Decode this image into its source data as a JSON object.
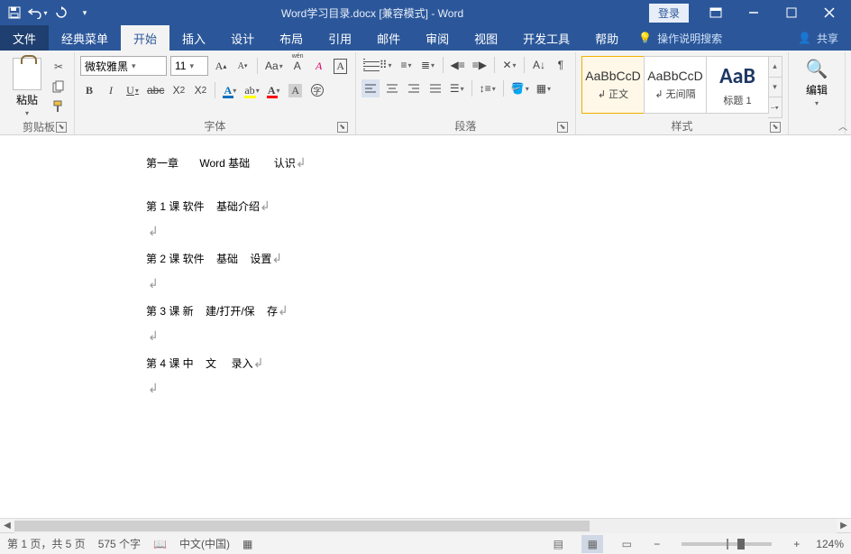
{
  "title": "Word学习目录.docx [兼容模式] - Word",
  "login": "登录",
  "tabs": {
    "file": "文件",
    "classic": "经典菜单",
    "home": "开始",
    "insert": "插入",
    "design": "设计",
    "layout": "布局",
    "ref": "引用",
    "mail": "邮件",
    "review": "审阅",
    "view": "视图",
    "dev": "开发工具",
    "help": "帮助",
    "tell": "操作说明搜索",
    "share": "共享"
  },
  "ribbon": {
    "clipboard": {
      "paste": "粘贴",
      "label": "剪贴板"
    },
    "font": {
      "name": "微软雅黑",
      "size": "11",
      "label": "字体"
    },
    "paragraph": {
      "label": "段落"
    },
    "styles": {
      "label": "样式",
      "preview": "AaBbCcD",
      "preview_big": "AaB",
      "s1": "↲ 正文",
      "s2": "↲ 无间隔",
      "s3": "标题 1"
    },
    "editing": {
      "label": "编辑"
    }
  },
  "document": {
    "l1": "第一章       Word 基础        认识",
    "l2": "第 1 课 软件    基础介绍",
    "l3": "第 2 课 软件    基础    设置",
    "l4": "第 3 课 新    建/打开/保    存",
    "l5": "第 4 课 中    文     录入"
  },
  "status": {
    "page": "第 1 页，共 5 页",
    "words": "575 个字",
    "lang": "中文(中国)",
    "zoom": "124%"
  }
}
